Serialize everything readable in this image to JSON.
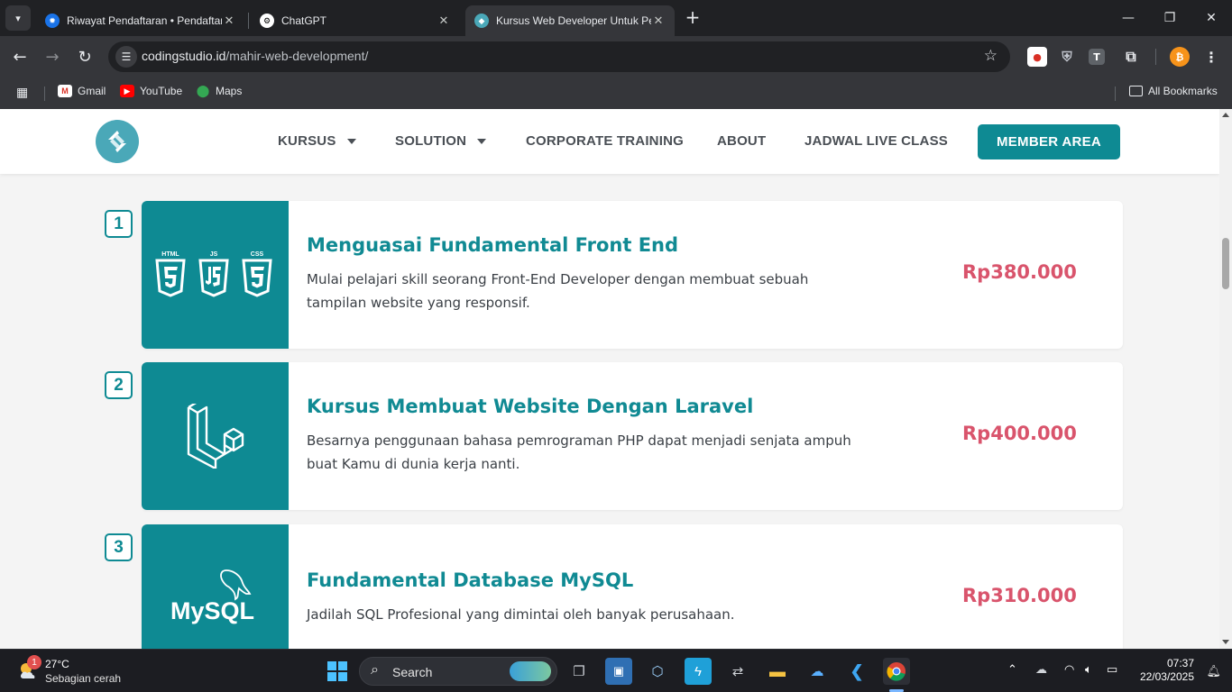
{
  "browser": {
    "tabs": [
      {
        "title": "Riwayat Pendaftaran • Pendaftaran",
        "active": false
      },
      {
        "title": "ChatGPT",
        "active": false
      },
      {
        "title": "Kursus Web Developer Untuk Pemula",
        "active": true
      }
    ],
    "url_host": "codingstudio.id",
    "url_path": "/mahir-web-development/",
    "bookmarks": [
      "Gmail",
      "YouTube",
      "Maps"
    ],
    "all_bookmarks": "All Bookmarks",
    "extension_t": "T"
  },
  "site": {
    "nav": [
      {
        "label": "KURSUS",
        "dropdown": true
      },
      {
        "label": "SOLUTION",
        "dropdown": true
      },
      {
        "label": "CORPORATE TRAINING",
        "dropdown": false
      },
      {
        "label": "ABOUT",
        "dropdown": false
      },
      {
        "label": "JADWAL LIVE CLASS",
        "dropdown": false
      }
    ],
    "member_button": "MEMBER AREA"
  },
  "courses": [
    {
      "number": "1",
      "title": "Menguasai Fundamental Front End",
      "description": "Mulai pelajari skill seorang Front-End Developer dengan membuat sebuah tampilan website yang responsif.",
      "price": "Rp380.000",
      "thumb_labels": [
        "HTML",
        "JS",
        "CSS"
      ]
    },
    {
      "number": "2",
      "title": "Kursus Membuat Website Dengan Laravel",
      "description": "Besarnya penggunaan bahasa pemrograman PHP dapat menjadi senjata ampuh buat Kamu di dunia kerja nanti.",
      "price": "Rp400.000"
    },
    {
      "number": "3",
      "title": "Fundamental Database MySQL",
      "description": "Jadilah SQL Profesional yang dimintai oleh banyak perusahaan.",
      "price": "Rp310.000",
      "thumb_label": "MySQL"
    }
  ],
  "taskbar": {
    "weather_temp": "27°C",
    "weather_desc": "Sebagian cerah",
    "weather_badge": "1",
    "search_label": "Search",
    "time": "07:37",
    "date": "22/03/2025"
  },
  "colors": {
    "accent": "#0e8a93",
    "price": "#d9546c",
    "chrome_dark": "#202124"
  }
}
